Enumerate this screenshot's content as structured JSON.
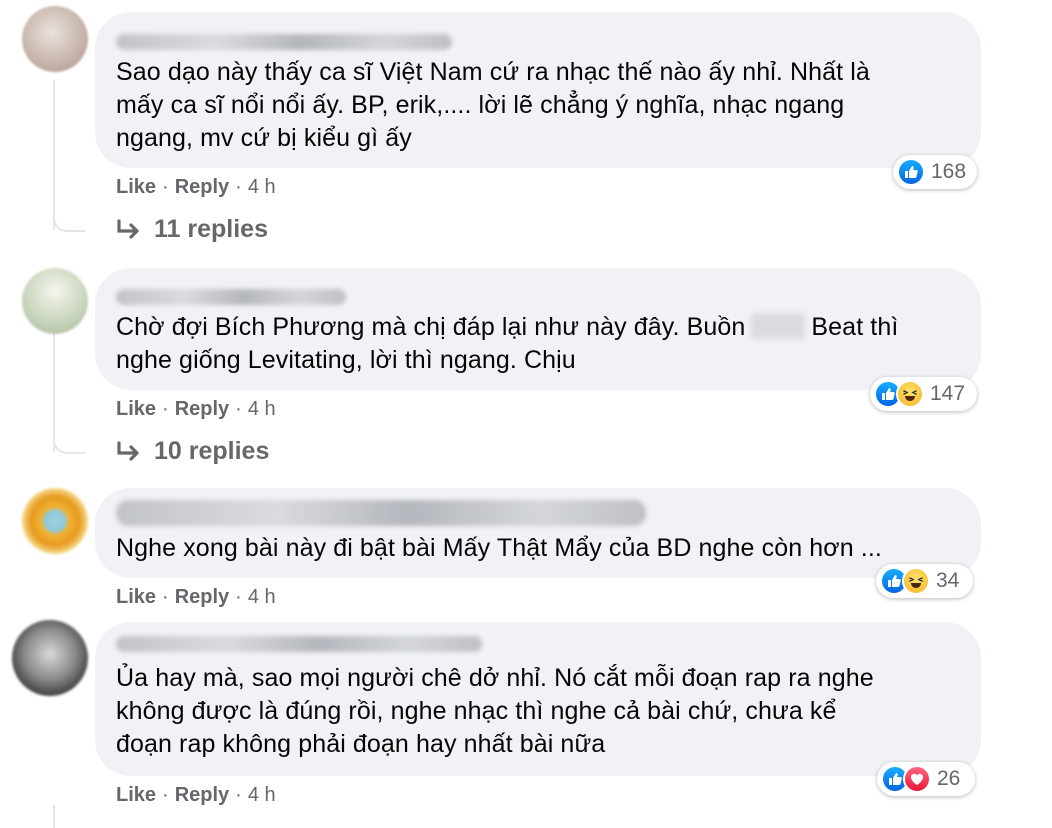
{
  "actions": {
    "like_label": "Like",
    "reply_label": "Reply",
    "separator": "·"
  },
  "comments": [
    {
      "text_lines": [
        "Sao dạo này thấy ca sĩ Việt Nam cứ ra nhạc thế nào ấy nhỉ. Nhất là",
        "mấy ca sĩ nổi nổi ấy. BP, erik,.... lời lẽ chẳng ý nghĩa, nhạc ngang",
        "ngang, mv cứ bị kiểu gì ấy"
      ],
      "time": "4 h",
      "reactions": [
        "like-icon"
      ],
      "reaction_count": "168",
      "replies_label": "11 replies"
    },
    {
      "text_lines": [
        "Chờ đợi Bích Phương mà chị đáp lại như này đây. Buồn",
        "nghe giống Levitating, lời thì ngang. Chịu"
      ],
      "text_line1_tail": "Beat thì",
      "time": "4 h",
      "reactions": [
        "like-icon",
        "haha-icon"
      ],
      "reaction_count": "147",
      "replies_label": "10 replies"
    },
    {
      "text_lines": [
        "Nghe xong bài này đi bật bài Mấy Thật Mẩy của BD nghe còn hơn ..."
      ],
      "time": "4 h",
      "reactions": [
        "like-icon",
        "haha-icon"
      ],
      "reaction_count": "34"
    },
    {
      "text_lines": [
        "Ủa hay mà, sao mọi người chê dở nhỉ. Nó cắt mỗi đoạn rap ra nghe",
        "không được là đúng rồi, nghe nhạc thì nghe cả bài chứ, chưa kể",
        "đoạn rap không phải đoạn hay nhất bài nữa"
      ],
      "time": "4 h",
      "reactions": [
        "like-icon",
        "love-icon"
      ],
      "reaction_count": "26"
    }
  ],
  "colors": {
    "bubble": "#f0f2f5",
    "meta_text": "#65676b",
    "like_blue": "#1877f2",
    "haha_yellow": "#f7b125",
    "love_red": "#f33e58"
  }
}
